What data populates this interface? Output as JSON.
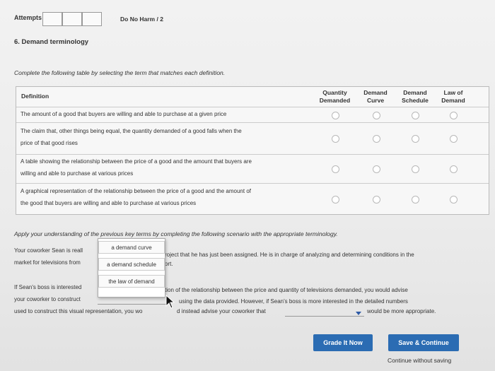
{
  "header": {
    "attempts_label": "Attempts",
    "score": "Do No Harm / 2"
  },
  "question": {
    "title": "6. Demand terminology",
    "instructions": "Complete the following table by selecting the term that matches each definition."
  },
  "table": {
    "headers": {
      "definition": "Definition",
      "qd_line1": "Quantity",
      "qd_line2": "Demanded",
      "dc_line1": "Demand",
      "dc_line2": "Curve",
      "ds_line1": "Demand",
      "ds_line2": "Schedule",
      "ld_line1": "Law of",
      "ld_line2": "Demand"
    },
    "rows": [
      {
        "line1": "The amount of a good that buyers are willing and able to purchase at a given price",
        "line2": ""
      },
      {
        "line1": "The claim that, other things being equal, the quantity demanded of a good falls when the",
        "line2": "price of that good rises"
      },
      {
        "line1": "A table showing the relationship between the price of a good and the amount that buyers are",
        "line2": "willing and able to purchase at various prices"
      },
      {
        "line1": "A graphical representation of the relationship between the price of a good and the amount of",
        "line2": "the good that buyers are willing and able to purchase at various prices"
      }
    ]
  },
  "scenario": {
    "instructions": "Apply your understanding of the previous key terms by completing the following scenario with the appropriate terminology.",
    "p1_a": "Your coworker Sean is reall",
    "p1_b": "roject that he has just been assigned. He is in charge of analyzing and determining conditions in the",
    "p1_c": "market for televisions from",
    "p1_d": "ort.",
    "p2_a": "If Sean's boss is interested",
    "p2_b": "tion of the relationship between the price and quantity of televisions demanded, you would advise",
    "p2_c": "your coworker to construct",
    "p2_d": "using the data provided. However, if Sean's boss is more interested in the detailed numbers",
    "p2_e": "used to construct this visual representation, you wo",
    "p2_f": "d instead advise your coworker that",
    "p2_g": "would be more appropriate."
  },
  "dropdown": {
    "options": [
      "a demand curve",
      "a demand schedule",
      "the law of demand"
    ]
  },
  "buttons": {
    "grade": "Grade It Now",
    "save": "Save & Continue",
    "continue_without_saving": "Continue without saving"
  },
  "colors": {
    "accent": "#2b6cb3",
    "dropdown_caret": "#2e5aa6"
  }
}
